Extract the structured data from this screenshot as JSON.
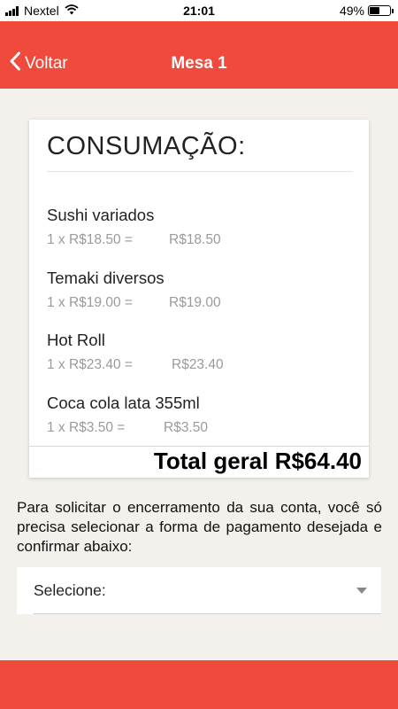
{
  "status_bar": {
    "carrier": "Nextel",
    "time": "21:01",
    "battery_percent": "49%",
    "battery_level": 0.49,
    "icons": [
      "signal-bars",
      "wifi",
      "battery"
    ]
  },
  "navbar": {
    "back_label": "Voltar",
    "title": "Mesa 1",
    "color": "#ef4a3c"
  },
  "consumption": {
    "title": "CONSUMAÇÃO:",
    "items": [
      {
        "name": "Sushi variados",
        "qty": "1 x R$18.50 =",
        "subtotal": "R$18.50"
      },
      {
        "name": "Temaki diversos",
        "qty": "1 x R$19.00 =",
        "subtotal": "R$19.00"
      },
      {
        "name": "Hot Roll",
        "qty": "1 x R$23.40 =",
        "subtotal": "R$23.40"
      },
      {
        "name": "Coca cola lata 355ml",
        "qty": "1 x R$3.50 =",
        "subtotal": "R$3.50"
      }
    ],
    "total": "Total geral R$64.40"
  },
  "instruction": "Para solicitar o encerramento da sua conta, você só precisa selecionar a forma de pagamento desejada e confirmar abaixo:",
  "payment_select": {
    "label": "Selecione:"
  },
  "colors": {
    "accent": "#ef4a3c",
    "background": "#f4f0ec"
  }
}
